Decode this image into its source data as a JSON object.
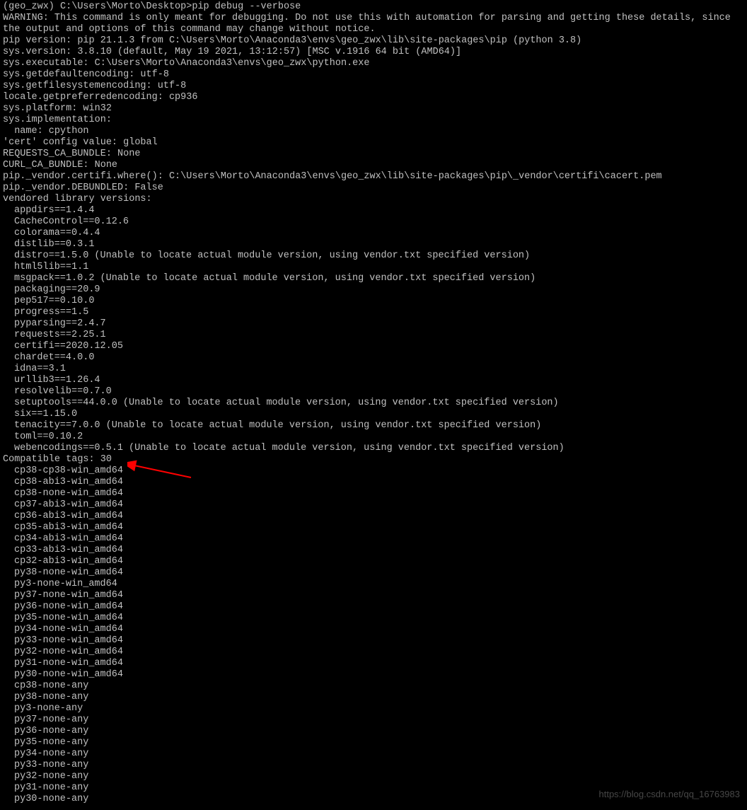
{
  "prompt": "(geo_zwx) C:\\Users\\Morto\\Desktop>pip debug --verbose",
  "warning": "WARNING: This command is only meant for debugging. Do not use this with automation for parsing and getting these details, since the output and options of this command may change without notice.",
  "info": {
    "pip_version": "pip version: pip 21.1.3 from C:\\Users\\Morto\\Anaconda3\\envs\\geo_zwx\\lib\\site-packages\\pip (python 3.8)",
    "sys_version": "sys.version: 3.8.10 (default, May 19 2021, 13:12:57) [MSC v.1916 64 bit (AMD64)]",
    "sys_executable": "sys.executable: C:\\Users\\Morto\\Anaconda3\\envs\\geo_zwx\\python.exe",
    "sys_getdefaultencoding": "sys.getdefaultencoding: utf-8",
    "sys_getfilesystemencoding": "sys.getfilesystemencoding: utf-8",
    "locale_getpreferredencoding": "locale.getpreferredencoding: cp936",
    "sys_platform": "sys.platform: win32",
    "sys_implementation": "sys.implementation:",
    "sys_impl_name": "  name: cpython",
    "cert_config": "'cert' config value: global",
    "requests_ca": "REQUESTS_CA_BUNDLE: None",
    "curl_ca": "CURL_CA_BUNDLE: None",
    "certifi_where": "pip._vendor.certifi.where(): C:\\Users\\Morto\\Anaconda3\\envs\\geo_zwx\\lib\\site-packages\\pip\\_vendor\\certifi\\cacert.pem",
    "debundled": "pip._vendor.DEBUNDLED: False",
    "vendored_header": "vendored library versions:"
  },
  "vendored": [
    "appdirs==1.4.4",
    "CacheControl==0.12.6",
    "colorama==0.4.4",
    "distlib==0.3.1",
    "distro==1.5.0 (Unable to locate actual module version, using vendor.txt specified version)",
    "html5lib==1.1",
    "msgpack==1.0.2 (Unable to locate actual module version, using vendor.txt specified version)",
    "packaging==20.9",
    "pep517==0.10.0",
    "progress==1.5",
    "pyparsing==2.4.7",
    "requests==2.25.1",
    "certifi==2020.12.05",
    "chardet==4.0.0",
    "idna==3.1",
    "urllib3==1.26.4",
    "resolvelib==0.7.0",
    "setuptools==44.0.0 (Unable to locate actual module version, using vendor.txt specified version)",
    "six==1.15.0",
    "tenacity==7.0.0 (Unable to locate actual module version, using vendor.txt specified version)",
    "toml==0.10.2",
    "webencodings==0.5.1 (Unable to locate actual module version, using vendor.txt specified version)"
  ],
  "compat_header": "Compatible tags: 30",
  "compat_tags": [
    "cp38-cp38-win_amd64",
    "cp38-abi3-win_amd64",
    "cp38-none-win_amd64",
    "cp37-abi3-win_amd64",
    "cp36-abi3-win_amd64",
    "cp35-abi3-win_amd64",
    "cp34-abi3-win_amd64",
    "cp33-abi3-win_amd64",
    "cp32-abi3-win_amd64",
    "py38-none-win_amd64",
    "py3-none-win_amd64",
    "py37-none-win_amd64",
    "py36-none-win_amd64",
    "py35-none-win_amd64",
    "py34-none-win_amd64",
    "py33-none-win_amd64",
    "py32-none-win_amd64",
    "py31-none-win_amd64",
    "py30-none-win_amd64",
    "cp38-none-any",
    "py38-none-any",
    "py3-none-any",
    "py37-none-any",
    "py36-none-any",
    "py35-none-any",
    "py34-none-any",
    "py33-none-any",
    "py32-none-any",
    "py31-none-any",
    "py30-none-any"
  ],
  "watermark": "https://blog.csdn.net/qq_16763983"
}
